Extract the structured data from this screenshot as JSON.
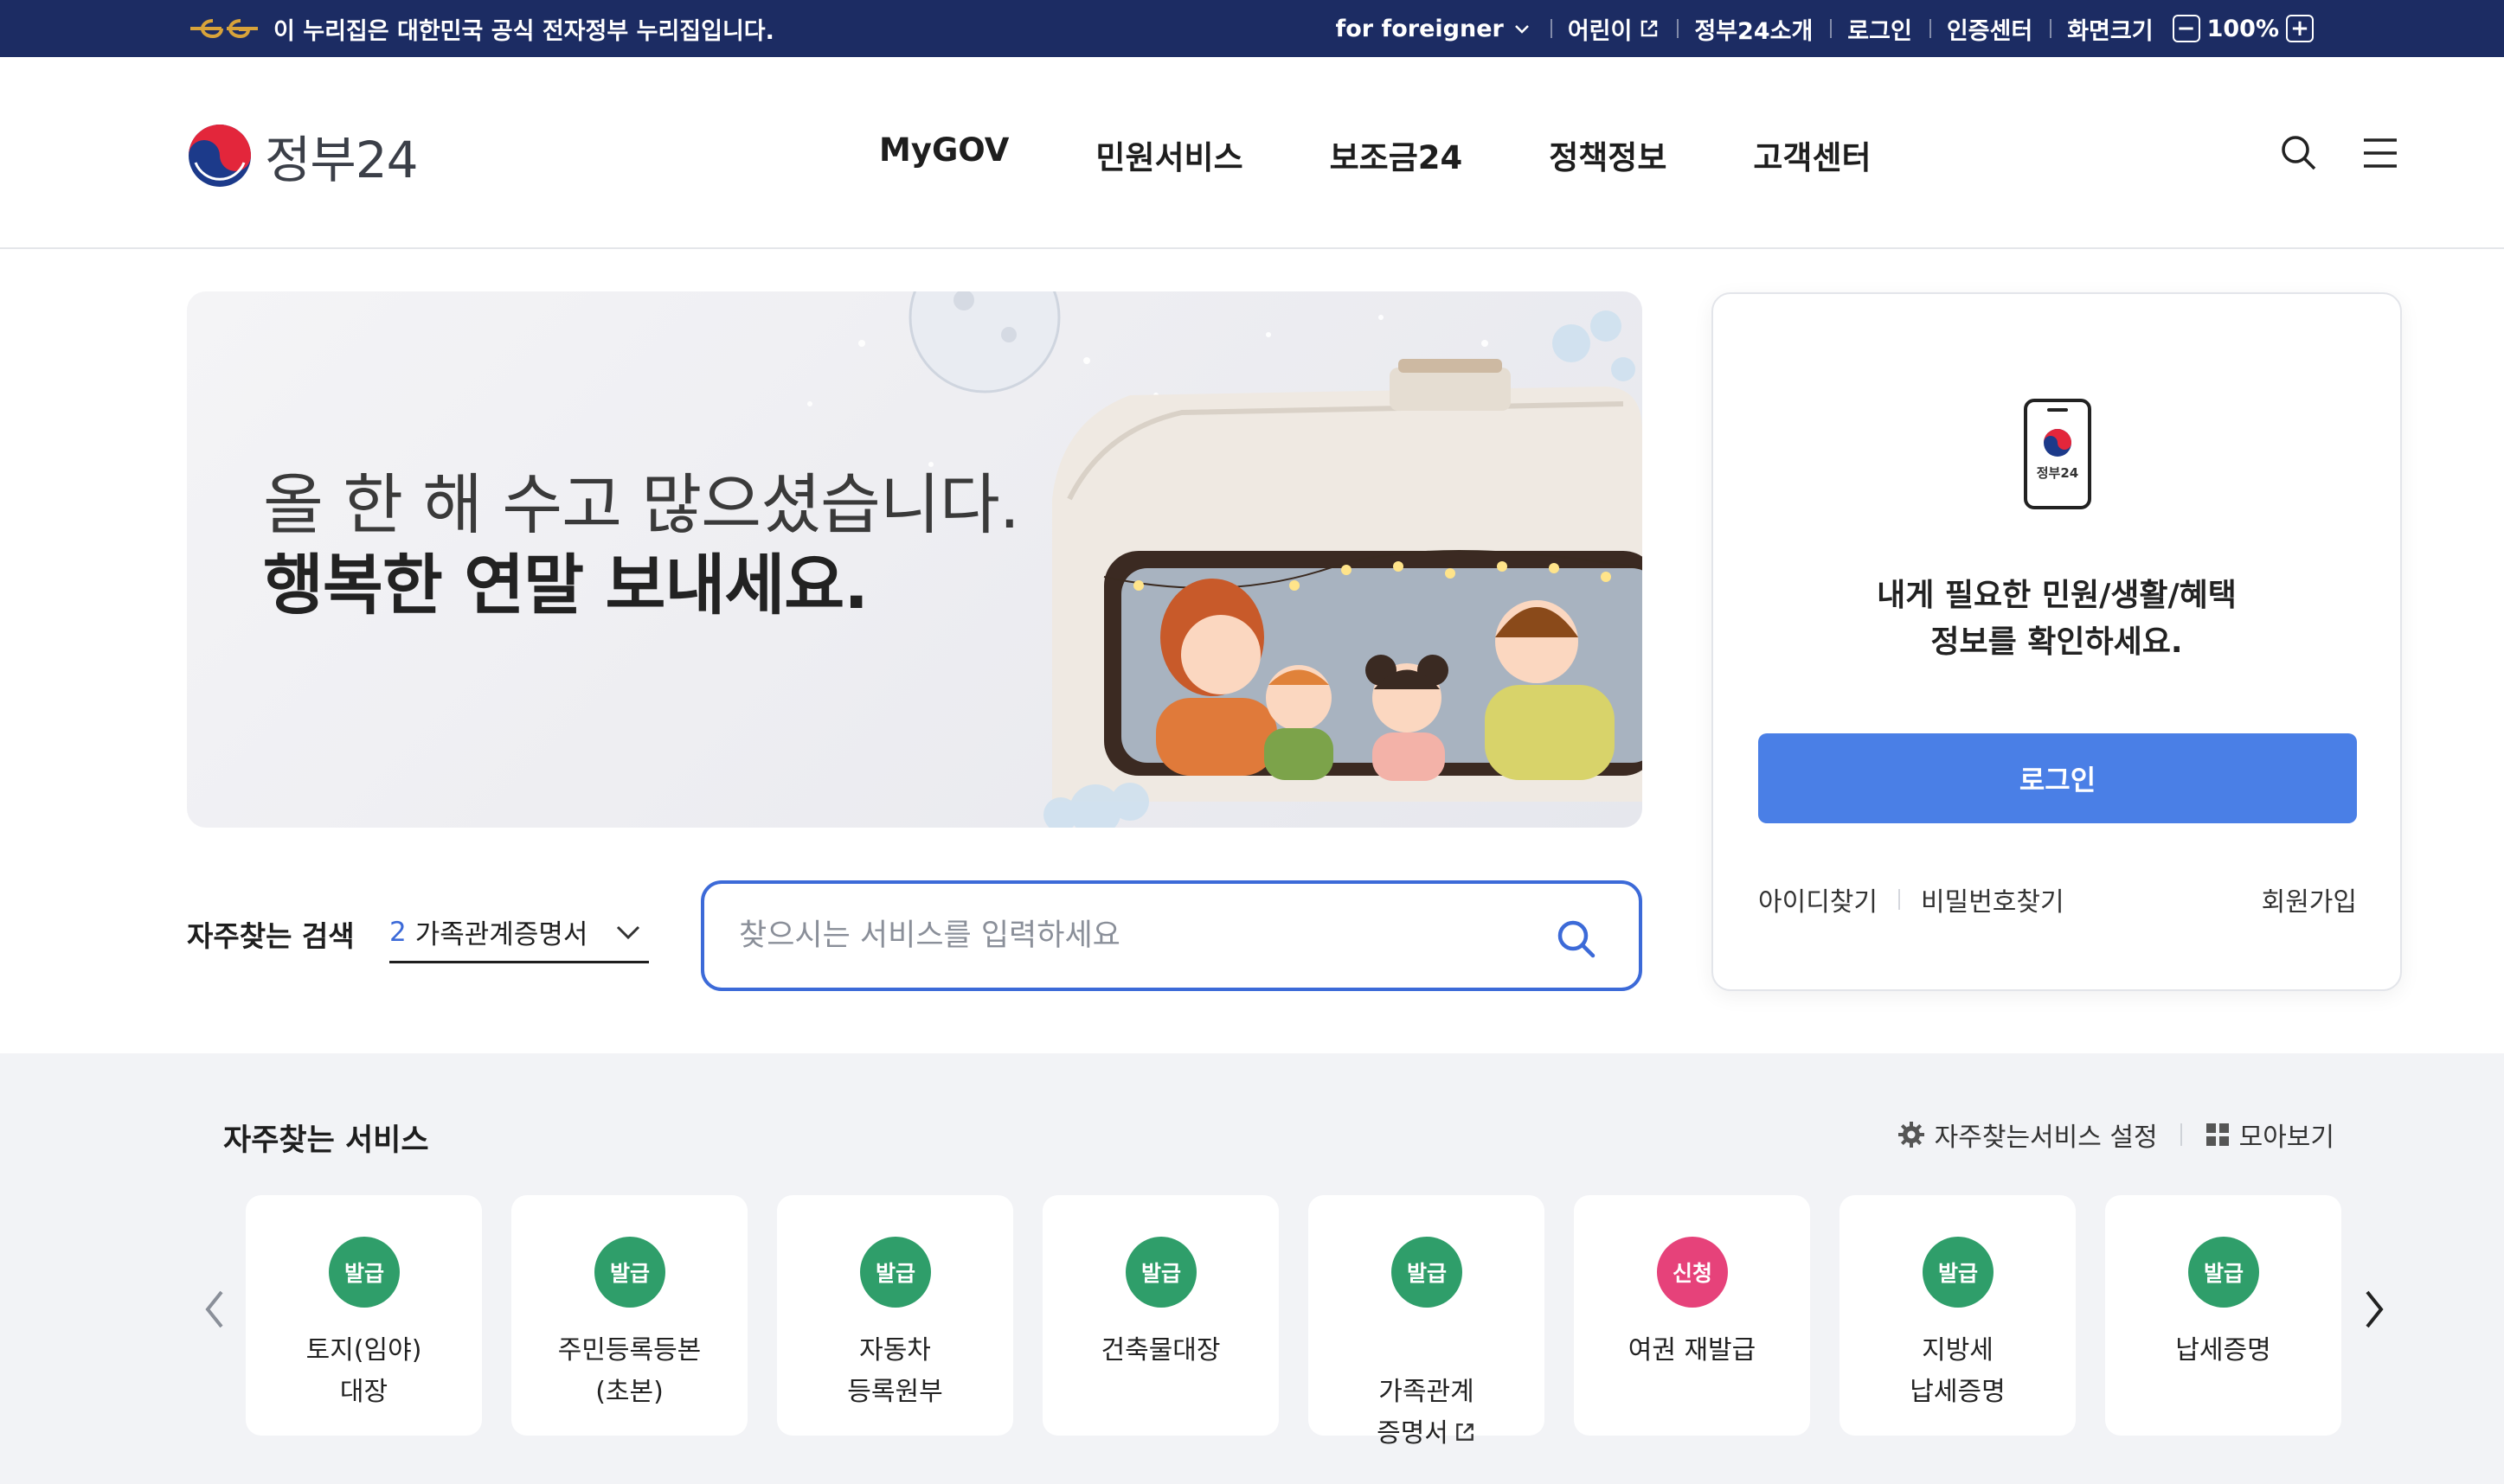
{
  "topbar": {
    "gov_notice": "이 누리집은 대한민국 공식 전자정부 누리집입니다.",
    "links": [
      {
        "label": "for foreigner",
        "icon": "chevron-down-icon"
      },
      {
        "label": "어린이",
        "icon": "external-link-icon"
      },
      {
        "label": "정부24소개"
      },
      {
        "label": "로그인"
      },
      {
        "label": "인증센터"
      },
      {
        "label": "화면크기"
      }
    ],
    "zoom_decrease": "−",
    "zoom_value": "100%",
    "zoom_increase": "+"
  },
  "header": {
    "logo_text": "정부24",
    "nav": [
      "MyGOV",
      "민원서비스",
      "보조금24",
      "정책정보",
      "고객센터"
    ]
  },
  "hero": {
    "line1": "올 한 해 수고 많으셨습니다.",
    "line2": "행복한 연말 보내세요."
  },
  "frequent_search": {
    "label": "자주찾는 검색",
    "rank": "2",
    "term": "가족관계증명서"
  },
  "search": {
    "placeholder": "찾으시는 서비스를 입력하세요"
  },
  "login_card": {
    "phone_label": "정부24",
    "message_line1": "내게 필요한 민원/생활/혜택",
    "message_line2": "정보를 확인하세요.",
    "login_button": "로그인",
    "find_id": "아이디찾기",
    "find_password": "비밀번호찾기",
    "signup": "회원가입"
  },
  "services": {
    "title": "자주찾는 서비스",
    "settings_label": "자주찾는서비스 설정",
    "view_all_label": "모아보기",
    "colors": {
      "issue": "#2f9e6a",
      "apply": "#e6427a"
    },
    "items": [
      {
        "badge": "발급",
        "type": "issue",
        "label": "토지(임야)\n대장"
      },
      {
        "badge": "발급",
        "type": "issue",
        "label": "주민등록등본\n(초본)"
      },
      {
        "badge": "발급",
        "type": "issue",
        "label": "자동차\n등록원부"
      },
      {
        "badge": "발급",
        "type": "issue",
        "label": "건축물대장"
      },
      {
        "badge": "발급",
        "type": "issue",
        "label": "가족관계\n증명서",
        "external": true
      },
      {
        "badge": "신청",
        "type": "apply",
        "label": "여권 재발급"
      },
      {
        "badge": "발급",
        "type": "issue",
        "label": "지방세\n납세증명"
      },
      {
        "badge": "발급",
        "type": "issue",
        "label": "납세증명"
      }
    ]
  }
}
